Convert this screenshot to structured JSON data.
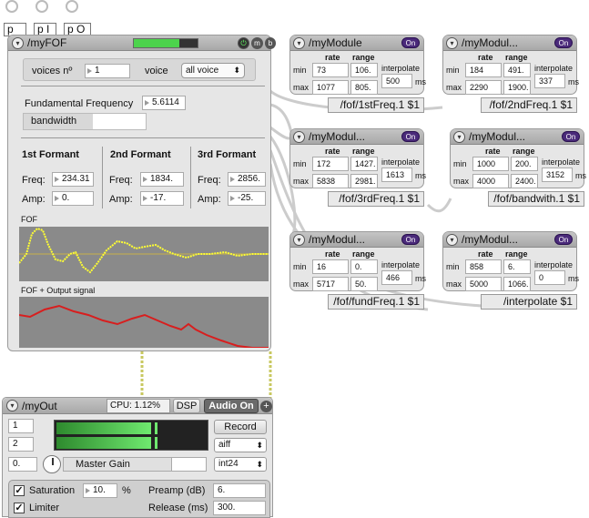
{
  "outlets": {
    "a": "p A",
    "i": "p I",
    "o": "p O"
  },
  "fof": {
    "title": "/myFOF",
    "voices_label": "voices nº",
    "voices_value": "1",
    "voice_label": "voice",
    "voice_select": "all voice",
    "fund_label": "Fundamental Frequency",
    "fund_value": "5.6114",
    "bandwidth_label": "bandwidth",
    "btn_m": "m",
    "btn_b": "b",
    "formants": [
      {
        "title": "1st Formant",
        "freq": "234.31",
        "amp": "0."
      },
      {
        "title": "2nd Formant",
        "freq": "1834.",
        "amp": "-17."
      },
      {
        "title": "3rd Formant",
        "freq": "2856.",
        "amp": "-25."
      }
    ],
    "freq_label": "Freq:",
    "amp_label": "Amp:",
    "scope1_label": "FOF",
    "scope2_label": "FOF + Output signal"
  },
  "module_labels": {
    "rate": "rate",
    "range": "range",
    "min": "min",
    "max": "max",
    "interpolate": "interpolate",
    "ms": "ms",
    "on": "On"
  },
  "modules": [
    {
      "title": "/myModule",
      "min_rate": "73",
      "min_range": "106.",
      "max_rate": "1077",
      "max_range": "805.",
      "interp": "500",
      "msg": "/fof/1stFreq.1 $1"
    },
    {
      "title": "/myModul...",
      "min_rate": "184",
      "min_range": "491.",
      "max_rate": "2290",
      "max_range": "1900.",
      "interp": "337",
      "msg": "/fof/2ndFreq.1 $1"
    },
    {
      "title": "/myModul...",
      "min_rate": "172",
      "min_range": "1427.",
      "max_rate": "5838",
      "max_range": "2981.",
      "interp": "1613",
      "msg": "/fof/3rdFreq.1 $1"
    },
    {
      "title": "/myModul...",
      "min_rate": "1000",
      "min_range": "200.",
      "max_rate": "4000",
      "max_range": "2400.",
      "interp": "3152",
      "msg": "/fof/bandwith.1 $1"
    },
    {
      "title": "/myModul...",
      "min_rate": "16",
      "min_range": "0.",
      "max_rate": "5717",
      "max_range": "50.",
      "interp": "466",
      "msg": "/fof/fundFreq.1 $1"
    },
    {
      "title": "/myModul...",
      "min_rate": "858",
      "min_range": "6.",
      "max_rate": "5000",
      "max_range": "1066.",
      "interp": "0",
      "msg": "/interpolate $1"
    }
  ],
  "out": {
    "title": "/myOut",
    "cpu": "CPU: 1.12%",
    "dsp": "DSP",
    "audio_on": "Audio On",
    "ch1": "1",
    "ch2": "2",
    "gain_value": "0.",
    "master_gain": "Master Gain",
    "record": "Record",
    "format": "aiff",
    "bits": "int24",
    "saturation_label": "Saturation",
    "saturation_value": "10.",
    "percent": "%",
    "limiter_label": "Limiter",
    "preamp_label": "Preamp (dB)",
    "preamp_value": "6.",
    "release_label": "Release (ms)",
    "release_value": "300."
  },
  "colors": {
    "accent": "#4a2a7a",
    "meter": "#4cd34c",
    "scope_line1": "#ffff33",
    "scope_line2": "#d81e1e"
  }
}
